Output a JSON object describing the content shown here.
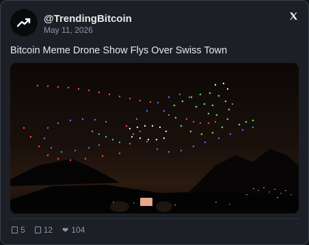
{
  "post": {
    "handle": "@TrendingBitcoin",
    "date": "May 11, 2026",
    "text": "Bitcoin Meme Drone Show Flys Over Swiss Town",
    "platform_icon": "x-logo-icon",
    "avatar_icon": "trending-up-arrow-icon"
  },
  "stats": {
    "replies": "5",
    "reposts": "12",
    "likes": "104"
  },
  "colors": {
    "card_bg": "#1c2026",
    "text_primary": "#e7e9ea",
    "text_secondary": "#8b98a5"
  }
}
